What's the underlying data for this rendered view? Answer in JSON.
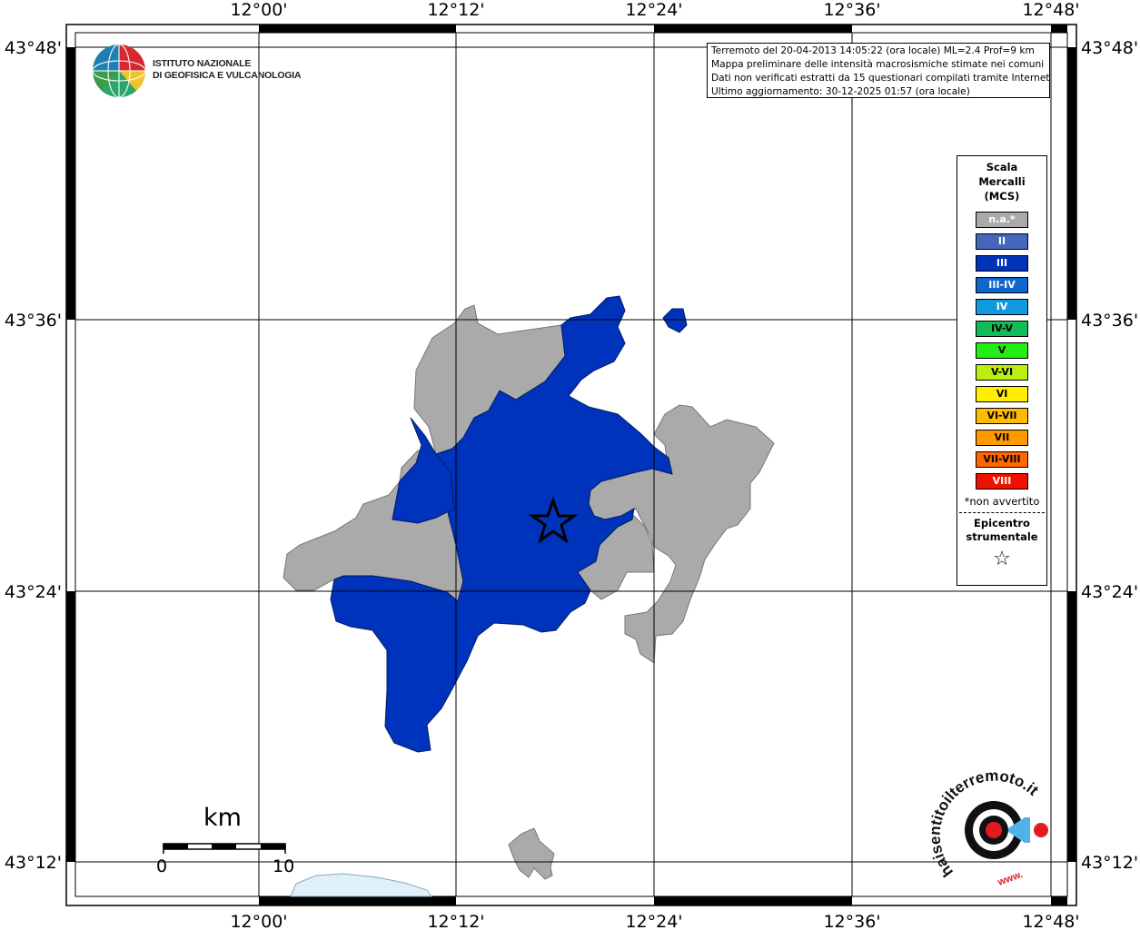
{
  "colors": {
    "intensity_III": "#0033bb",
    "not_felt": "#aaaaaa",
    "water": "#e0f0fa",
    "frame": "#000000",
    "grid": "#000000"
  },
  "axes": {
    "top_labels": [
      "12°00'",
      "12°12'",
      "12°24'",
      "12°36'",
      "12°48'"
    ],
    "bottom_labels": [
      "12°00'",
      "12°12'",
      "12°24'",
      "12°36'",
      "12°48'"
    ],
    "left_labels": [
      "43°48'",
      "43°36'",
      "43°24'",
      "43°12'"
    ],
    "right_labels": [
      "43°48'",
      "43°36'",
      "43°24'",
      "43°12'"
    ]
  },
  "info_box": {
    "line1": "Terremoto del 20-04-2013 14:05:22 (ora locale) ML=2.4 Prof=9 km",
    "line2": "Mappa preliminare delle intensità macrosismiche stimate nei comuni",
    "line3": "Dati non verificati estratti da 15 questionari compilati tramite Internet.",
    "line4": "Ultimo aggiornamento: 30-12-2025 01:57 (ora locale)"
  },
  "logo": {
    "line1": "ISTITUTO NAZIONALE",
    "line2": "DI GEOFISICA E VULCANOLOGIA",
    "icon": "ingv-globe-logo"
  },
  "legend": {
    "title1": "Scala",
    "title2": "Mercalli",
    "title3": "(MCS)",
    "items": [
      {
        "label": "n.a.*",
        "color": "#aaaaaa",
        "text_color": "#ffffff"
      },
      {
        "label": "II",
        "color": "#4466bb",
        "text_color": "#ffffff"
      },
      {
        "label": "III",
        "color": "#0033bb",
        "text_color": "#ffffff"
      },
      {
        "label": "III-IV",
        "color": "#1166cc",
        "text_color": "#ffffff"
      },
      {
        "label": "IV",
        "color": "#1199dd",
        "text_color": "#ffffff"
      },
      {
        "label": "IV-V",
        "color": "#11bb55",
        "text_color": "#000000"
      },
      {
        "label": "V",
        "color": "#22ee11",
        "text_color": "#000000"
      },
      {
        "label": "V-VI",
        "color": "#bbee11",
        "text_color": "#000000"
      },
      {
        "label": "VI",
        "color": "#ffee00",
        "text_color": "#000000"
      },
      {
        "label": "VI-VII",
        "color": "#ffbb00",
        "text_color": "#000000"
      },
      {
        "label": "VII",
        "color": "#ff9900",
        "text_color": "#000000"
      },
      {
        "label": "VII-VIII",
        "color": "#ff6600",
        "text_color": "#000000"
      },
      {
        "label": "VIII",
        "color": "#ee1100",
        "text_color": "#ffffff"
      }
    ],
    "note": "*non avvertito",
    "epicenter1": "Epicentro",
    "epicenter2": "strumentale",
    "epicenter_icon": "☆"
  },
  "scale_bar": {
    "unit": "km",
    "start": "0",
    "end": "10"
  },
  "hst_logo": {
    "text": "haisentitoilterremoto.it",
    "prefix": "www.",
    "icon": "hst-target-logo"
  },
  "epicenter": {
    "symbol": "star-icon"
  }
}
